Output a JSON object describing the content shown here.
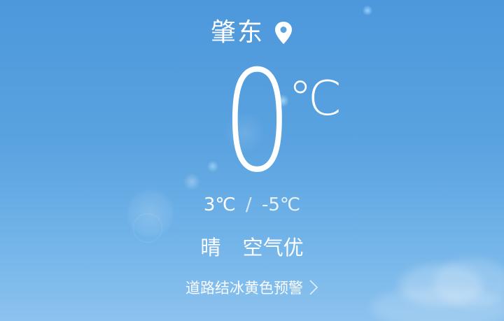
{
  "location": {
    "city": "肇东",
    "icon": "location-pin-icon"
  },
  "current": {
    "temperature": "0",
    "unit": "℃"
  },
  "range": {
    "high": "3℃",
    "separator": "/",
    "low": "-5℃"
  },
  "condition": {
    "weather": "晴",
    "air_quality": "空气优"
  },
  "alert": {
    "text": "道路结冰黄色预警",
    "icon": "chevron-right-icon"
  },
  "colors": {
    "sky_top": "#4d98dc",
    "sky_bottom": "#8cc2ee",
    "text": "#ffffff"
  }
}
